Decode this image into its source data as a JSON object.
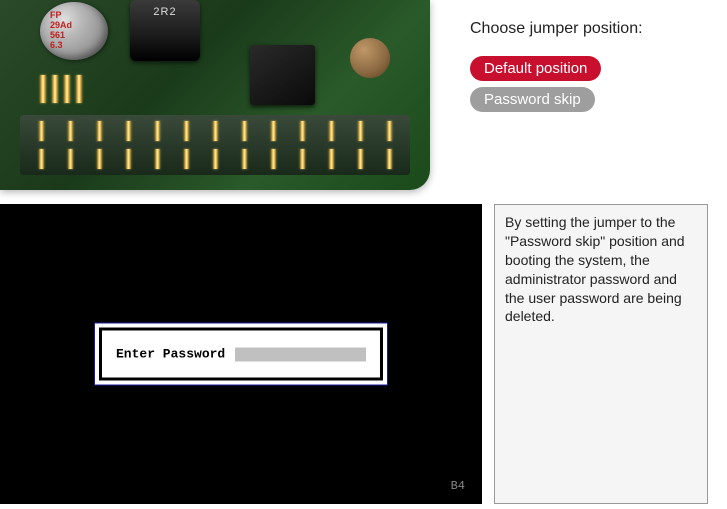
{
  "options": {
    "title": "Choose jumper position:",
    "default_label": "Default position",
    "skip_label": "Password skip"
  },
  "pcb": {
    "cap_text1": "FP",
    "cap_text2": "29Ad",
    "cap_text3": "561",
    "cap_text4": "6.3",
    "inductor_label": "2R2"
  },
  "bios": {
    "prompt_label": "Enter Password",
    "footer_code": "B4"
  },
  "info": {
    "text": "By setting the jumper to the \"Password skip\" position and booting the system, the administrator password and the user password are being deleted."
  }
}
